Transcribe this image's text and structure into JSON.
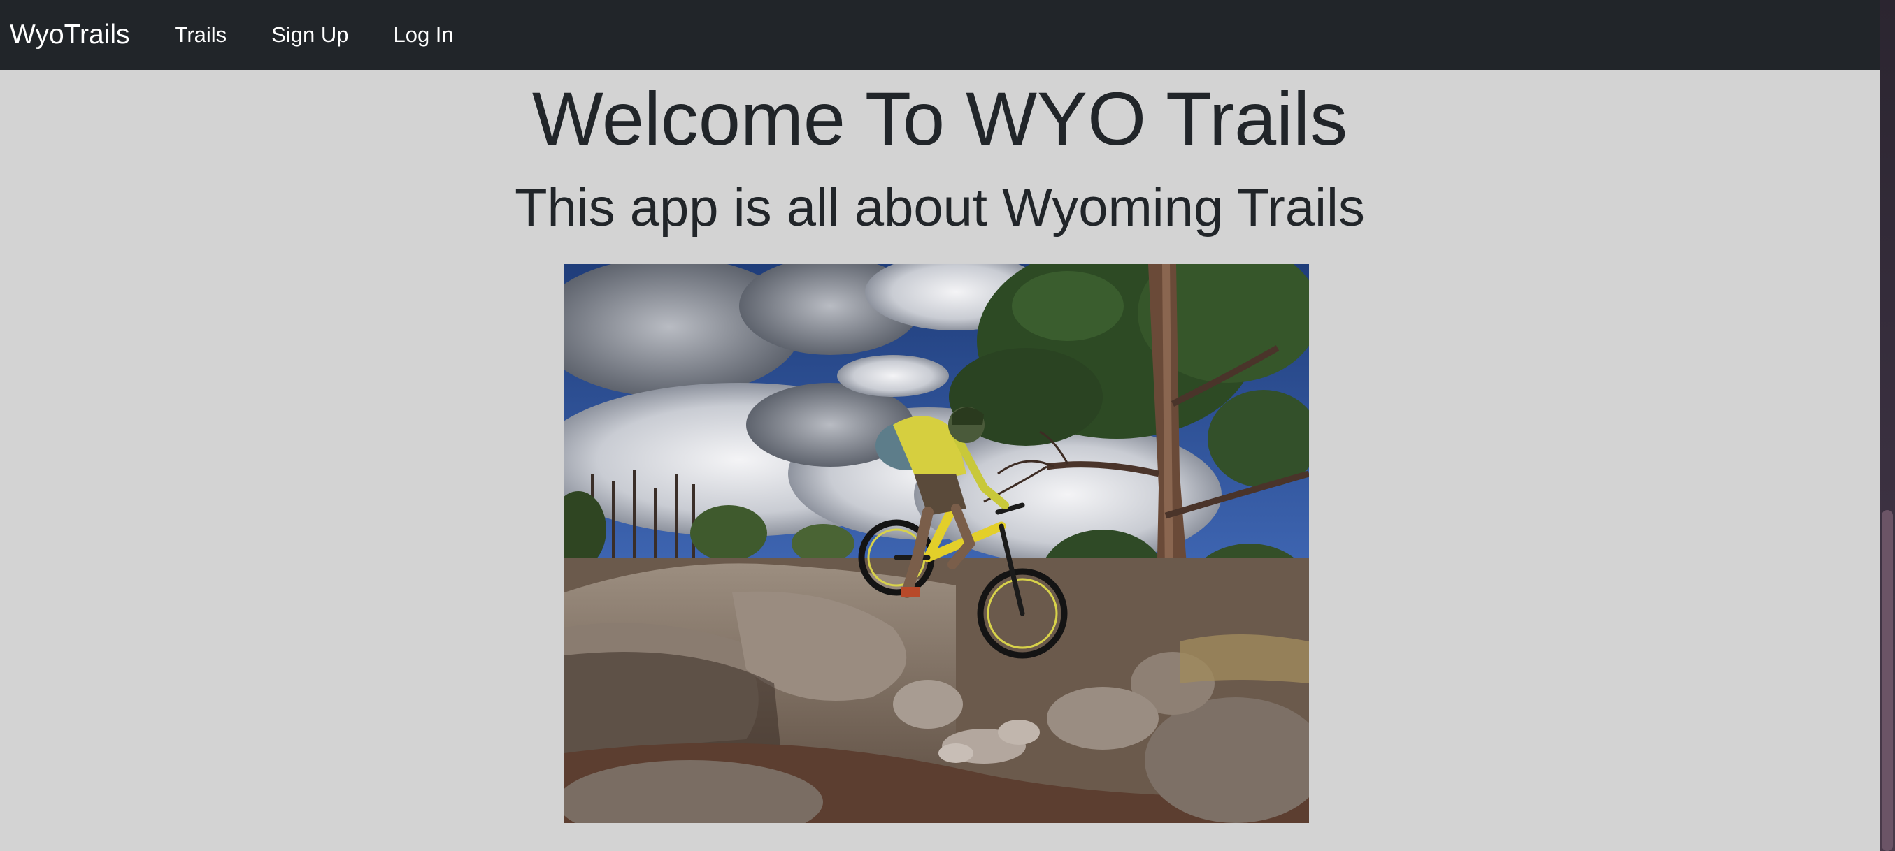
{
  "navbar": {
    "brand": "WyoTrails",
    "links": [
      {
        "label": "Trails"
      },
      {
        "label": "Sign Up"
      },
      {
        "label": "Log In"
      }
    ],
    "background_color": "#212529"
  },
  "main": {
    "title": "Welcome To WYO Trails",
    "subtitle": "This app is all about Wyoming Trails",
    "background_color": "#d3d3d3"
  }
}
